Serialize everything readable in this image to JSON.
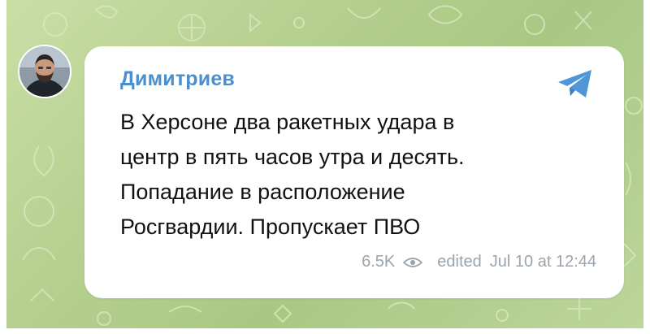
{
  "post": {
    "sender_name": "Димитриев",
    "message_lines": [
      "В Херсоне два ракетных удара в",
      "центр в пять часов утра и десять.",
      "Попадание в расположение",
      "Росгвардии. Пропускает ПВО"
    ],
    "views": "6.5K",
    "edited_label": "edited",
    "timestamp": "Jul 10 at 12:44",
    "icons": {
      "avatar": "avatar-photo",
      "channel": "telegram-icon",
      "views": "eye-icon"
    }
  },
  "colors": {
    "sender_name": "#4a8fd0",
    "telegram_icon": "#4f97d8",
    "meta_text": "#9aa4ad",
    "chat_background": "#b5cf8e"
  }
}
